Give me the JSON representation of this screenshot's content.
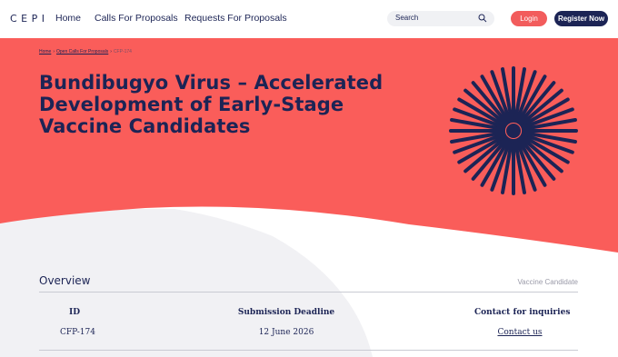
{
  "header": {
    "logo": "CEPI",
    "nav": {
      "home": "Home",
      "calls": "Calls For Proposals",
      "requests": "Requests For Proposals"
    },
    "search": {
      "label": "Search",
      "icon": "search-icon"
    },
    "login_label": "Login",
    "register_label": "Register Now"
  },
  "breadcrumb": {
    "home": "Home",
    "open_calls": "Open Calls For Proposals",
    "current": "CFP-174"
  },
  "hero": {
    "title": "Bundibugyo Virus – Accelerated Development of Early-Stage Vaccine Candidates",
    "icon": "sunburst-icon"
  },
  "overview": {
    "title": "Overview",
    "tag": "Vaccine Candidate",
    "columns": [
      {
        "label": "ID",
        "value": "CFP-174"
      },
      {
        "label": "Submission Deadline",
        "value": "12 June 2026"
      },
      {
        "label": "Contact for inquiries",
        "value": "Contact us"
      }
    ]
  },
  "colors": {
    "navy": "#1c2455",
    "coral": "#f25c5c",
    "hero_bg": "#fa5d5a"
  }
}
